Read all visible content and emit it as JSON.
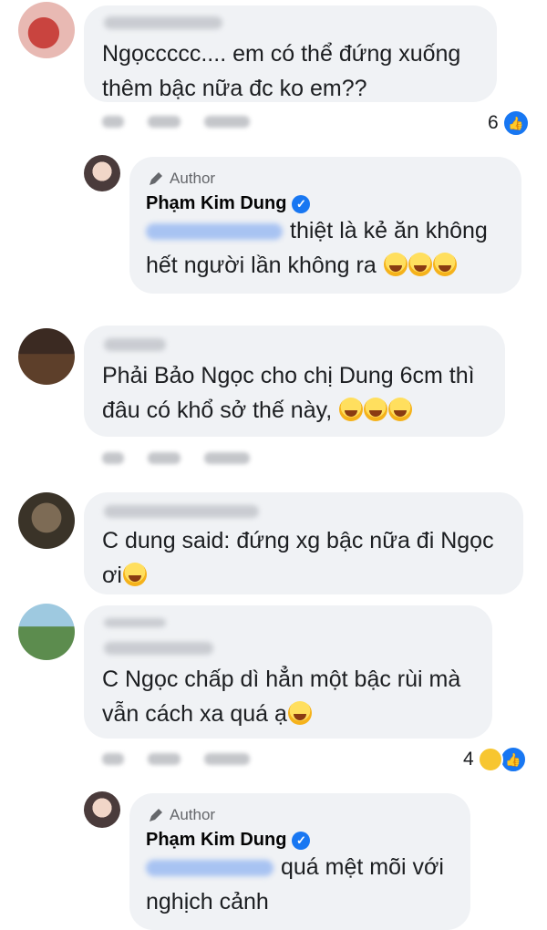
{
  "comments": [
    {
      "text_lines": [
        "Ngọccccc.... em có thể đứng xuống",
        "thêm bậc nữa đc ko em??"
      ],
      "reaction_count": "6"
    },
    {
      "author_badge": "Author",
      "author_name": "Phạm Kim Dung",
      "text_line1": "thiệt là kẻ ăn không",
      "text_line2": "hết người lần không ra"
    },
    {
      "text_lines": [
        "Phải Bảo Ngọc cho chị Dung 6cm thì",
        "đâu có khổ sở thế này,"
      ]
    },
    {
      "text_lines": [
        "C dung said: đứng xg bậc nữa đi Ngọc",
        "ơi"
      ]
    },
    {
      "text_lines": [
        "C Ngọc chấp dì hẳn một bậc rùi mà",
        "vẫn cách xa quá ạ"
      ],
      "reaction_count": "4"
    },
    {
      "author_badge": "Author",
      "author_name": "Phạm Kim Dung",
      "text_line1": "quá mệt mõi với",
      "text_line2": "nghịch cảnh"
    }
  ],
  "colors": {
    "bubble": "#f0f2f5",
    "like": "#1877f2",
    "haha": "#f7c630"
  }
}
